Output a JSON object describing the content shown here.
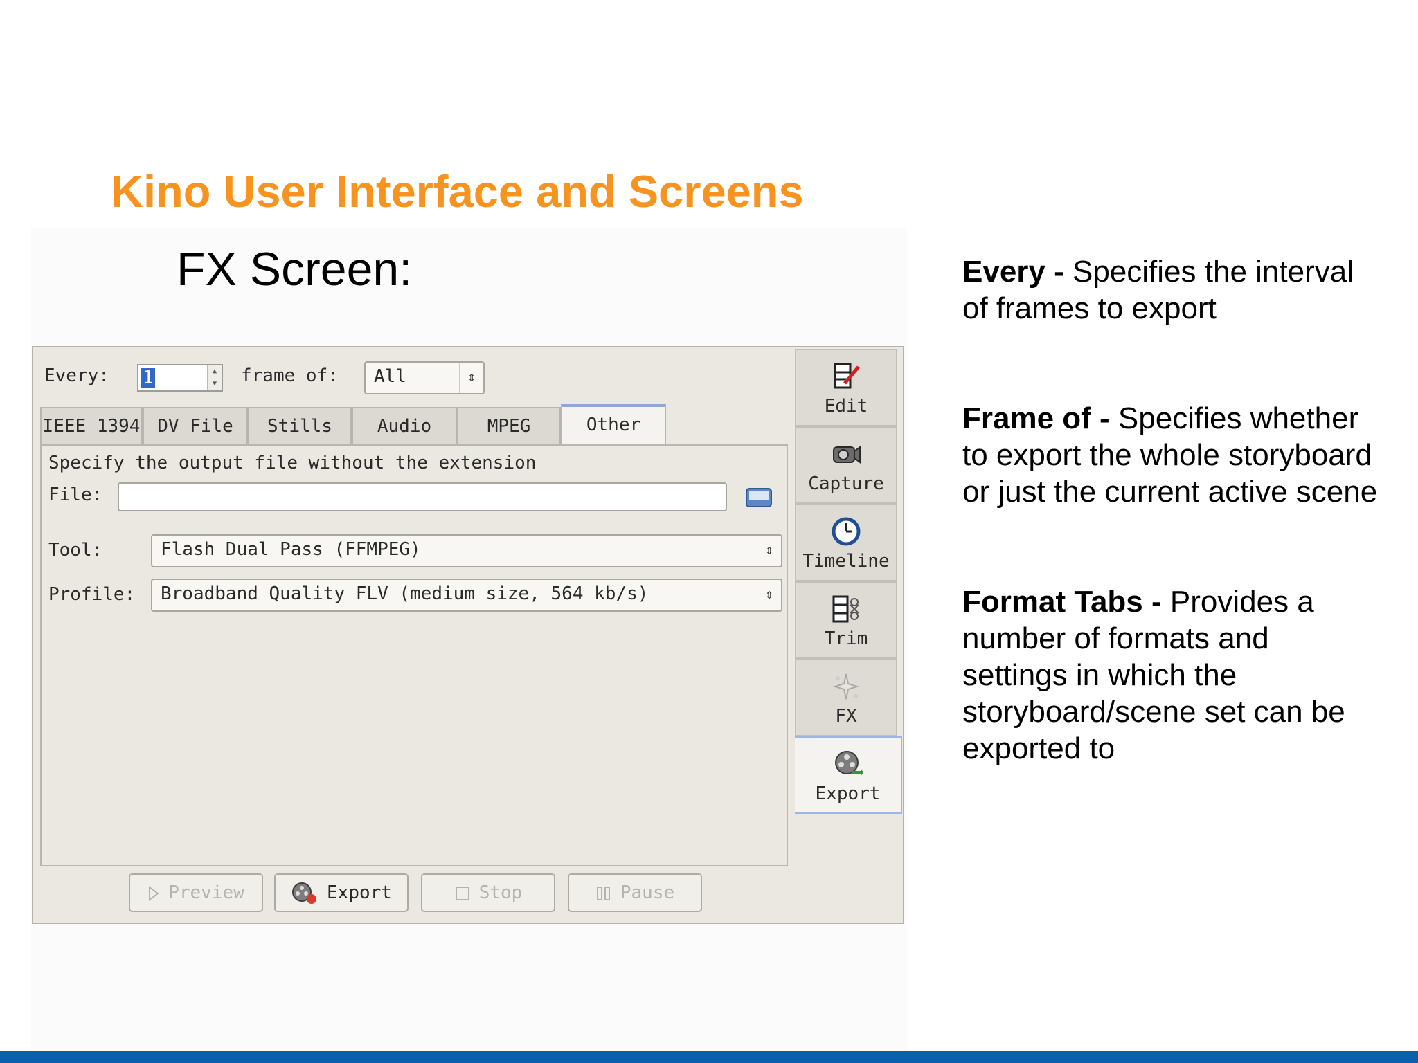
{
  "slide": {
    "title": "Kino User Interface and Screens",
    "subtitle": "FX Screen:"
  },
  "colors": {
    "title": "#f7931e",
    "bar": "#0a60ad",
    "selection": "#3368c9"
  },
  "notes": [
    {
      "term": "Every -",
      "text": " Specifies the interval of frames to export"
    },
    {
      "term": "Frame of -",
      "text": " Specifies whether to export the whole storyboard or just the current active scene"
    },
    {
      "term": "Format Tabs -",
      "text": " Provides a number of formats and settings in which the storyboard/scene set can be exported to"
    }
  ],
  "kino": {
    "every_label": "Every:",
    "every_value": "1",
    "frame_of_label": "frame of:",
    "frame_of_value": "All",
    "tabs": [
      "IEEE 1394",
      "DV File",
      "Stills",
      "Audio",
      "MPEG",
      "Other"
    ],
    "active_tab": "Other",
    "hint": "Specify the output file without the extension",
    "file_label": "File:",
    "file_value": "",
    "tool_label": "Tool:",
    "tool_value": "Flash Dual Pass (FFMPEG)",
    "profile_label": "Profile:",
    "profile_value": "Broadband Quality FLV (medium size, 564 kb/s)",
    "buttons": [
      {
        "label": "Preview",
        "icon": "play-icon",
        "enabled": false
      },
      {
        "label": "Export",
        "icon": "export-reel-icon",
        "enabled": true
      },
      {
        "label": "Stop",
        "icon": "stop-icon",
        "enabled": false
      },
      {
        "label": "Pause",
        "icon": "pause-icon",
        "enabled": false
      }
    ],
    "sidebar": [
      {
        "label": "Edit",
        "icon": "edit-icon"
      },
      {
        "label": "Capture",
        "icon": "camera-icon"
      },
      {
        "label": "Timeline",
        "icon": "clock-icon"
      },
      {
        "label": "Trim",
        "icon": "trim-icon"
      },
      {
        "label": "FX",
        "icon": "sparkle-icon"
      },
      {
        "label": "Export",
        "icon": "export-reel-icon"
      }
    ],
    "active_sidebar": "Export"
  }
}
